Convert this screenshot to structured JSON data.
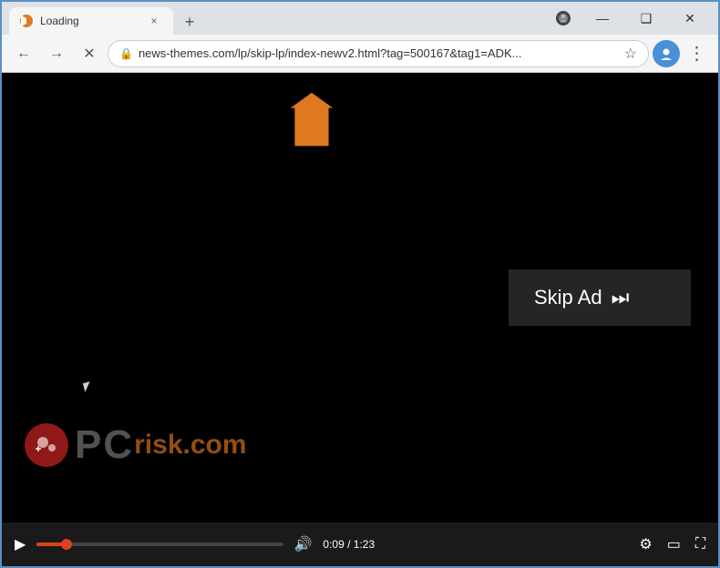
{
  "browser": {
    "title": "Loading",
    "tab_close": "×",
    "tab_new": "+",
    "address": "news-themes.com/lp/skip-lp/index-newv2.html?tag=500167&tag1=ADK...",
    "win_minimize": "—",
    "win_restore": "❑",
    "win_close": "✕",
    "nav_back": "←",
    "nav_forward": "→",
    "nav_close": "✕"
  },
  "video": {
    "skip_ad_label": "Skip Ad",
    "skip_ad_icon": "⏭",
    "time_current": "0:09",
    "time_total": "1:23",
    "watermark_text": "PC",
    "watermark_domain": "risk.com"
  },
  "colors": {
    "accent": "#e07820",
    "progress": "#e04020",
    "browser_bg": "#dee1e6",
    "video_bg": "#000000",
    "controls_bg": "#1a1a1a"
  }
}
